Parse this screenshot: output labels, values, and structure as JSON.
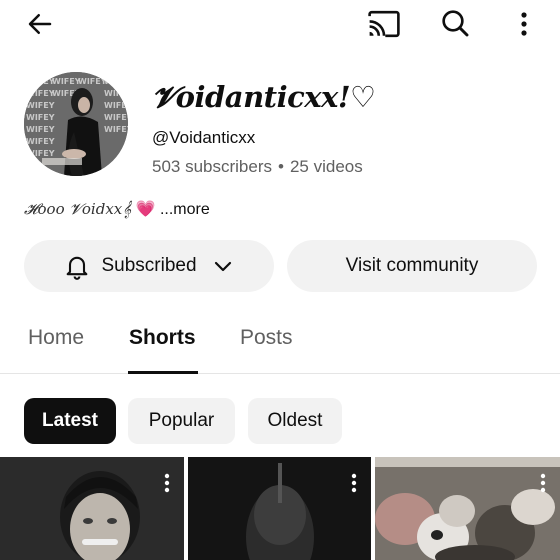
{
  "icons": {
    "back": "arrow-left-icon",
    "cast": "cast-icon",
    "search": "search-icon",
    "more": "more-vertical-icon",
    "bell": "bell-icon",
    "chevron": "chevron-down-icon"
  },
  "channel": {
    "name": "𝓥oidanticxx!♡",
    "handle": "@Voidanticxx",
    "subscribers": "503 subscribers",
    "separator": "•",
    "videos": "25 videos",
    "avatar_text": "WIFEY",
    "bio": {
      "text": "𝓗ooo 𝓥oidxx𝄞",
      "emoji": "💗",
      "more_label": "...more"
    }
  },
  "actions": {
    "subscribed_label": "Subscribed",
    "community_label": "Visit community"
  },
  "tabs": [
    {
      "label": "Home",
      "active": false
    },
    {
      "label": "Shorts",
      "active": true
    },
    {
      "label": "Posts",
      "active": false
    }
  ],
  "chips": [
    {
      "label": "Latest",
      "selected": true
    },
    {
      "label": "Popular",
      "selected": false
    },
    {
      "label": "Oldest",
      "selected": false
    }
  ],
  "colors": {
    "text_primary": "#0f0f0f",
    "text_secondary": "#606060",
    "chip_bg": "#f2f2f2",
    "chip_selected_bg": "#0f0f0f"
  }
}
